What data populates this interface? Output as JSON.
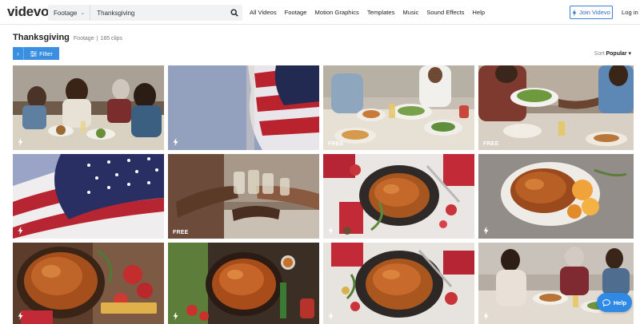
{
  "brand": {
    "logo": "videvo",
    "accent": "#3b8fe0"
  },
  "search": {
    "category": "Footage",
    "query": "Thanksgiving"
  },
  "nav": {
    "items": [
      "All Videos",
      "Footage",
      "Motion Graphics",
      "Templates",
      "Music",
      "Sound Effects",
      "Help"
    ]
  },
  "header": {
    "join_label": "Join Videvo",
    "login_label": "Log in"
  },
  "page": {
    "title": "Thanksgiving",
    "type": "Footage",
    "separator": "|",
    "clip_count": "185 clips"
  },
  "toolbar": {
    "filter_label": "Filter",
    "sort_prefix": "Sort",
    "sort_value": "Popular"
  },
  "results": {
    "tiles": [
      {
        "subject": "family praying at dinner table",
        "badge": "bolt",
        "label": ""
      },
      {
        "subject": "american flag waving",
        "badge": "bolt",
        "label": ""
      },
      {
        "subject": "dinner table with salads",
        "badge": "free",
        "label": "FREE"
      },
      {
        "subject": "passing salad bowl",
        "badge": "free",
        "label": "FREE"
      },
      {
        "subject": "american flag close-up",
        "badge": "bolt",
        "label": ""
      },
      {
        "subject": "toasting glasses",
        "badge": "free",
        "label": "FREE"
      },
      {
        "subject": "roast turkey with ornaments",
        "badge": "bolt",
        "label": ""
      },
      {
        "subject": "roast turkey with oranges",
        "badge": "bolt",
        "label": ""
      },
      {
        "subject": "roast turkey with apples",
        "badge": "bolt",
        "label": ""
      },
      {
        "subject": "roast turkey with herbs",
        "badge": "bolt",
        "label": ""
      },
      {
        "subject": "roast turkey in pan",
        "badge": "bolt",
        "label": ""
      },
      {
        "subject": "family holiday dinner",
        "badge": "bolt",
        "label": ""
      }
    ]
  },
  "support": {
    "help_label": "Help"
  }
}
